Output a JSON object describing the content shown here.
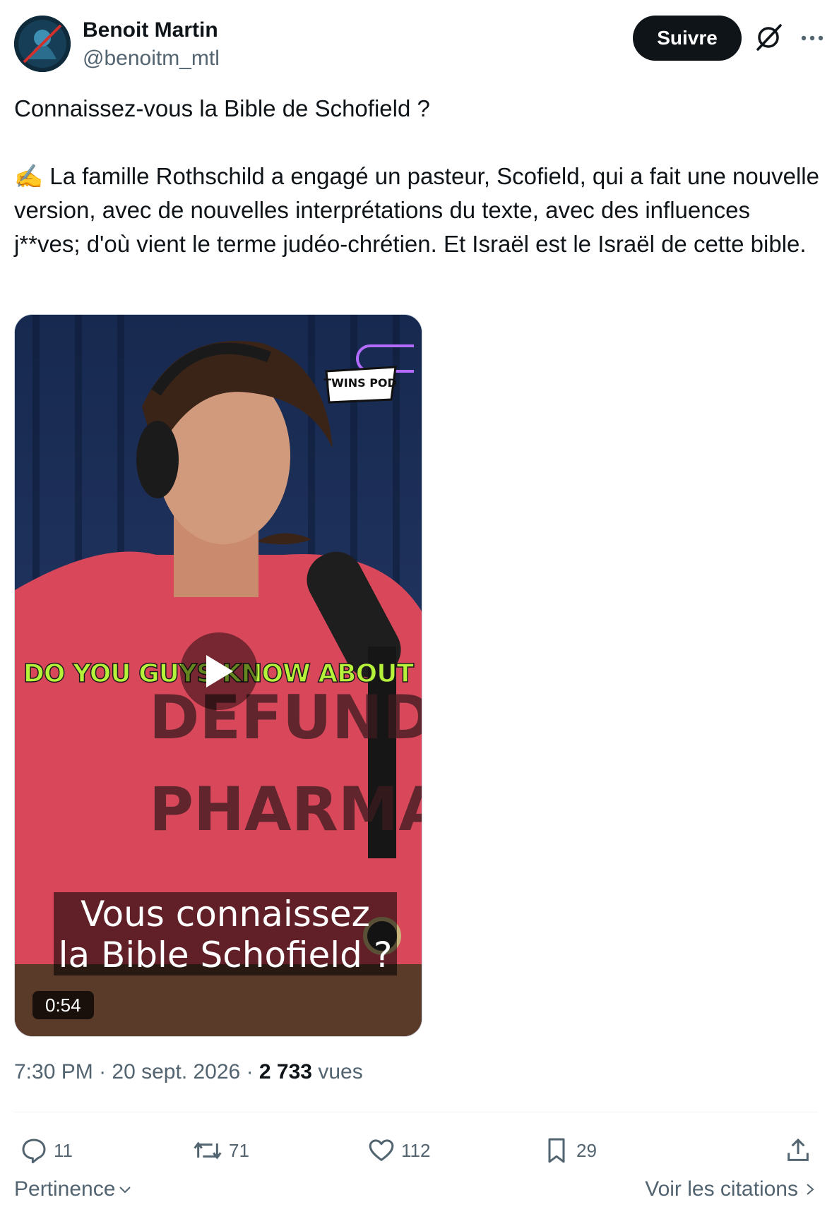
{
  "author": {
    "name": "Benoit Martin",
    "handle": "@benoitm_mtl"
  },
  "header": {
    "follow_label": "Suivre"
  },
  "tweet": {
    "text": "Connaissez-vous la Bible de Schofield ?\n\n✍️ La famille Rothschild a engagé un pasteur, Scofield, qui a fait une nouvelle version, avec de nouvelles interprétations du texte, avec des influences j**ves; d'où vient le terme judéo-chrétien. Et Israël est le Israël de cette bible."
  },
  "video": {
    "overlay_caption": "DO YOU GUYS KNOW ABOUT",
    "subtitle": "Vous connaissez\nla Bible Schofield ?",
    "duration": "0:54",
    "watermark": "TWINS POD"
  },
  "meta": {
    "time": "7:30 PM",
    "date": "20 sept. 2026",
    "views_count": "2 733",
    "views_label": "vues"
  },
  "actions": {
    "replies": "11",
    "reposts": "71",
    "likes": "112",
    "bookmarks": "29"
  },
  "footer": {
    "sort_label": "Pertinence",
    "quotes_label": "Voir les citations"
  },
  "colors": {
    "text": "#0f1419",
    "secondary": "#536471",
    "follow_bg": "#0f1419",
    "caption_green": "#b6f23a"
  }
}
